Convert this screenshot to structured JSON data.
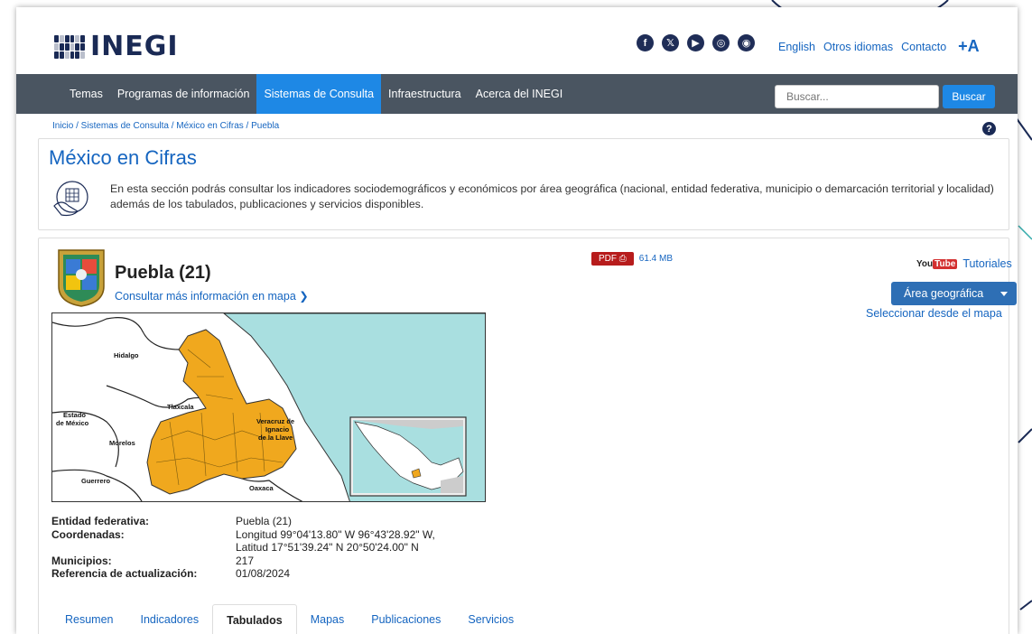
{
  "header": {
    "logo_text": "INEGI",
    "social": [
      {
        "name": "facebook-icon",
        "glyph": "f"
      },
      {
        "name": "x-icon",
        "glyph": "𝕏"
      },
      {
        "name": "youtube-icon",
        "glyph": "▶"
      },
      {
        "name": "instagram-icon",
        "glyph": "◎"
      },
      {
        "name": "rss-icon",
        "glyph": "◉"
      }
    ],
    "links": [
      "English",
      "Otros idiomas",
      "Contacto"
    ],
    "font_size_toggle": "+A"
  },
  "nav": {
    "items": [
      "Temas",
      "Programas de información",
      "Sistemas de Consulta",
      "Infraestructura",
      "Acerca del INEGI"
    ],
    "active_index": 2,
    "search_placeholder": "Buscar...",
    "search_button": "Buscar"
  },
  "breadcrumb": "Inicio / Sistemas de Consulta / México en Cifras / Puebla",
  "intro": {
    "title": "México en Cifras",
    "text": "En esta sección podrás consultar los indicadores sociodemográficos y económicos por área geográfica (nacional, entidad federativa, municipio o demarcación territorial y localidad) además de los tabulados, publicaciones y servicios disponibles."
  },
  "entity": {
    "title": "Puebla (21)",
    "map_link": "Consultar más información en mapa",
    "pdf_label": "PDF",
    "pdf_size": "61.4 MB",
    "tutorials_label": "Tutoriales",
    "youtube_badge": "You",
    "youtube_badge_tube": "Tube",
    "area_button": "Área geográfica",
    "select_map_link": "Seleccionar desde el mapa"
  },
  "map_labels": {
    "hidalgo": "Hidalgo",
    "tlaxcala": "Tlaxcala",
    "estado_l1": "Estado",
    "estado_l2": "de México",
    "morelos": "Morelos",
    "guerrero": "Guerrero",
    "oaxaca": "Oaxaca",
    "veracruz_l1": "Veracruz de",
    "veracruz_l2": "Ignacio",
    "veracruz_l3": "de la Llave"
  },
  "details": [
    {
      "label": "Entidad federativa:",
      "values": [
        "Puebla (21)"
      ]
    },
    {
      "label": "Coordenadas:",
      "values": [
        "Longitud  99°04'13.80\" W  96°43'28.92\" W,",
        "Latitud  17°51'39.24\" N  20°50'24.00\" N"
      ]
    },
    {
      "label": "Municipios:",
      "values": [
        "217"
      ]
    },
    {
      "label": "Referencia de actualización:",
      "values": [
        "01/08/2024"
      ]
    }
  ],
  "tabs": [
    "Resumen",
    "Indicadores",
    "Tabulados",
    "Mapas",
    "Publicaciones",
    "Servicios"
  ],
  "active_tab": 2,
  "colors": {
    "nav_bg": "#4a5561",
    "accent": "#1e88e5",
    "link": "#1565c0",
    "puebla_fill": "#f0a81e",
    "water": "#a9dfe0"
  }
}
